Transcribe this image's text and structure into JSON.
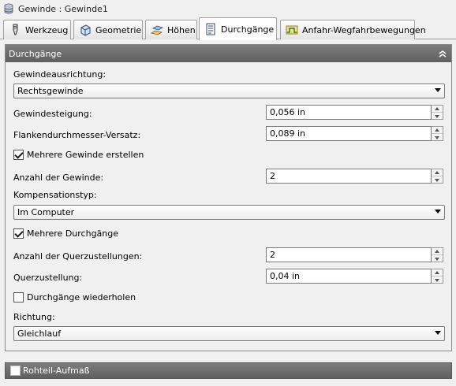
{
  "window": {
    "title": "Gewinde : Gewinde1"
  },
  "tabs": [
    {
      "label": "Werkzeug",
      "icon": "tool-icon"
    },
    {
      "label": "Geometrie",
      "icon": "cube-icon"
    },
    {
      "label": "Höhen",
      "icon": "heights-icon"
    },
    {
      "label": "Durchgänge",
      "icon": "passes-icon",
      "active": true
    },
    {
      "label": "Anfahr-Wegfahrbewegungen",
      "icon": "linking-icon"
    }
  ],
  "panel": {
    "title": "Durchgänge",
    "thread_direction": {
      "label": "Gewindeausrichtung:",
      "value": "Rechtsgewinde"
    },
    "thread_pitch": {
      "label": "Gewindesteigung:",
      "value": "0,056 in"
    },
    "pitch_diameter_offset": {
      "label": "Flankendurchmesser-Versatz:",
      "value": "0,089 in"
    },
    "multiple_threads": {
      "label": "Mehrere Gewinde erstellen",
      "checked": true
    },
    "thread_count": {
      "label": "Anzahl der Gewinde:",
      "value": "2"
    },
    "compensation": {
      "label": "Kompensationstyp:",
      "value": "Im Computer"
    },
    "multiple_passes": {
      "label": "Mehrere Durchgänge",
      "checked": true
    },
    "stepover_count": {
      "label": "Anzahl der Querzustellungen:",
      "value": "2"
    },
    "stepover": {
      "label": "Querzustellung:",
      "value": "0,04 in"
    },
    "repeat_passes": {
      "label": "Durchgänge wiederholen",
      "checked": false
    },
    "direction": {
      "label": "Richtung:",
      "value": "Gleichlauf"
    }
  },
  "stock_section": {
    "label": "Rohteil-Aufmaß",
    "checked": false
  }
}
